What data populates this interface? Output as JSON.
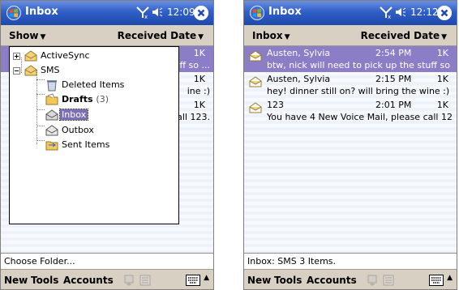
{
  "left": {
    "title": "Inbox",
    "clock": "12:09",
    "filter_left": "Show",
    "filter_right": "Received Date",
    "background_rows": [
      {
        "size": "1K",
        "preview": "uff so ..."
      },
      {
        "size": "1K",
        "preview": "ine :)"
      },
      {
        "size": "1K",
        "preview": "call 123."
      }
    ],
    "tree": {
      "activesync": "ActiveSync",
      "sms": "SMS",
      "deleted": "Deleted Items",
      "drafts": "Drafts",
      "drafts_count": "(3)",
      "inbox": "Inbox",
      "outbox": "Outbox",
      "sent": "Sent Items"
    },
    "status": "Choose Folder...",
    "menu": {
      "new": "New",
      "tools": "Tools",
      "accounts": "Accounts"
    }
  },
  "right": {
    "title": "Inbox",
    "clock": "12:12",
    "filter_left": "Inbox",
    "filter_right": "Received Date",
    "messages": [
      {
        "sender": "Austen, Sylvia",
        "time": "2:54 PM",
        "size": "1K",
        "preview": "btw, nick will need to pick up the stuff so ..."
      },
      {
        "sender": "Austen, Sylvia",
        "time": "2:15 PM",
        "size": "1K",
        "preview": "hey! dinner still on? will bring the wine :)"
      },
      {
        "sender": "123",
        "time": "2:01 PM",
        "size": "1K",
        "preview": "You have 4 New Voice Mail, please call 123."
      }
    ],
    "status": "Inbox: SMS  3 Items.",
    "menu": {
      "new": "New",
      "tools": "Tools",
      "accounts": "Accounts"
    }
  },
  "icons": {
    "start": "windows-flag-icon",
    "signal": "antenna-off-icon",
    "volume": "speaker-icon",
    "close": "close-icon",
    "message": "envelope-open-icon",
    "folder": "folder-icon",
    "keyboard": "keyboard-icon"
  },
  "colors": {
    "titlebar": "#2f5fc8",
    "selection": "#8c7ec6",
    "menubar": "#d9d0c4"
  }
}
